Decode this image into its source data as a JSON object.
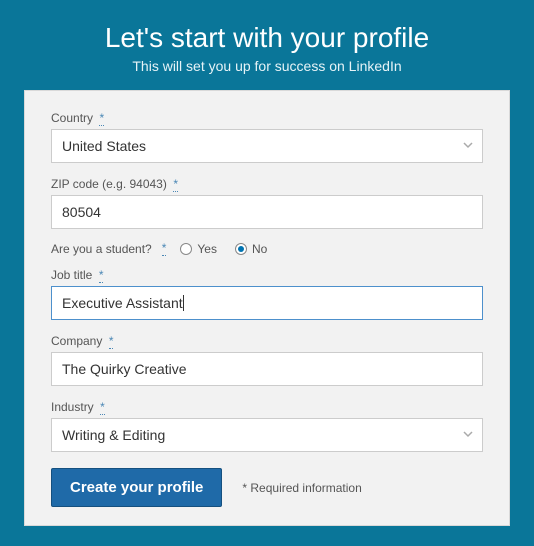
{
  "header": {
    "title": "Let's start with your profile",
    "subtitle": "This will set you up for success on LinkedIn"
  },
  "form": {
    "country": {
      "label": "Country",
      "value": "United States"
    },
    "zip": {
      "label": "ZIP code (e.g. 94043)",
      "value": "80504"
    },
    "student": {
      "label": "Are you a student?",
      "options": {
        "yes": "Yes",
        "no": "No"
      },
      "selected": "no"
    },
    "job_title": {
      "label": "Job title",
      "value": "Executive Assistant"
    },
    "company": {
      "label": "Company",
      "value": "The Quirky Creative"
    },
    "industry": {
      "label": "Industry",
      "value": "Writing & Editing"
    },
    "required_glyph": "*",
    "submit_label": "Create your profile",
    "required_note": "* Required information"
  }
}
